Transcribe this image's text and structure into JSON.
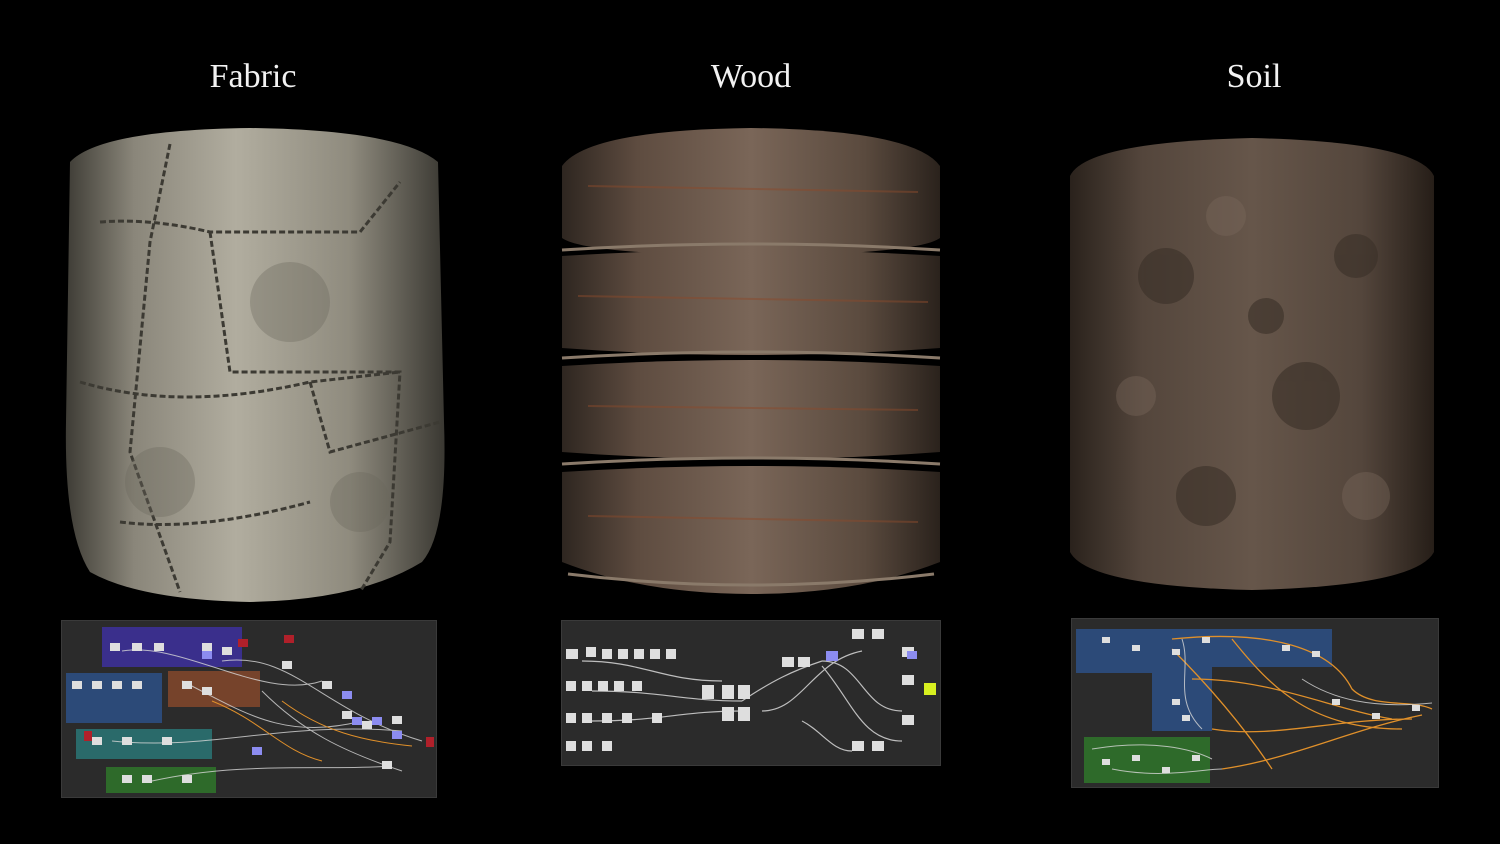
{
  "materials": [
    {
      "title": "Fabric",
      "colors": {
        "base": "#8e8a7c",
        "light": "#b9b5a6",
        "dark": "#4a4840",
        "seam": "#3a3832"
      }
    },
    {
      "title": "Wood",
      "colors": {
        "base": "#5e4c40",
        "light": "#8a7466",
        "dark": "#2e2620",
        "accent": "#8a4a2c"
      }
    },
    {
      "title": "Soil",
      "colors": {
        "base": "#5a4a40",
        "light": "#7a6a5c",
        "dark": "#2a221c"
      }
    }
  ],
  "graph_colors": {
    "background": "#2b2b2b",
    "purple": "#3a2f8c",
    "blue": "#2c4a78",
    "orange": "#8a4a2c",
    "teal": "#2a6a6a",
    "green": "#2e6a2a",
    "wire": "#d8d8d8",
    "wire_orange": "#e0902a"
  }
}
